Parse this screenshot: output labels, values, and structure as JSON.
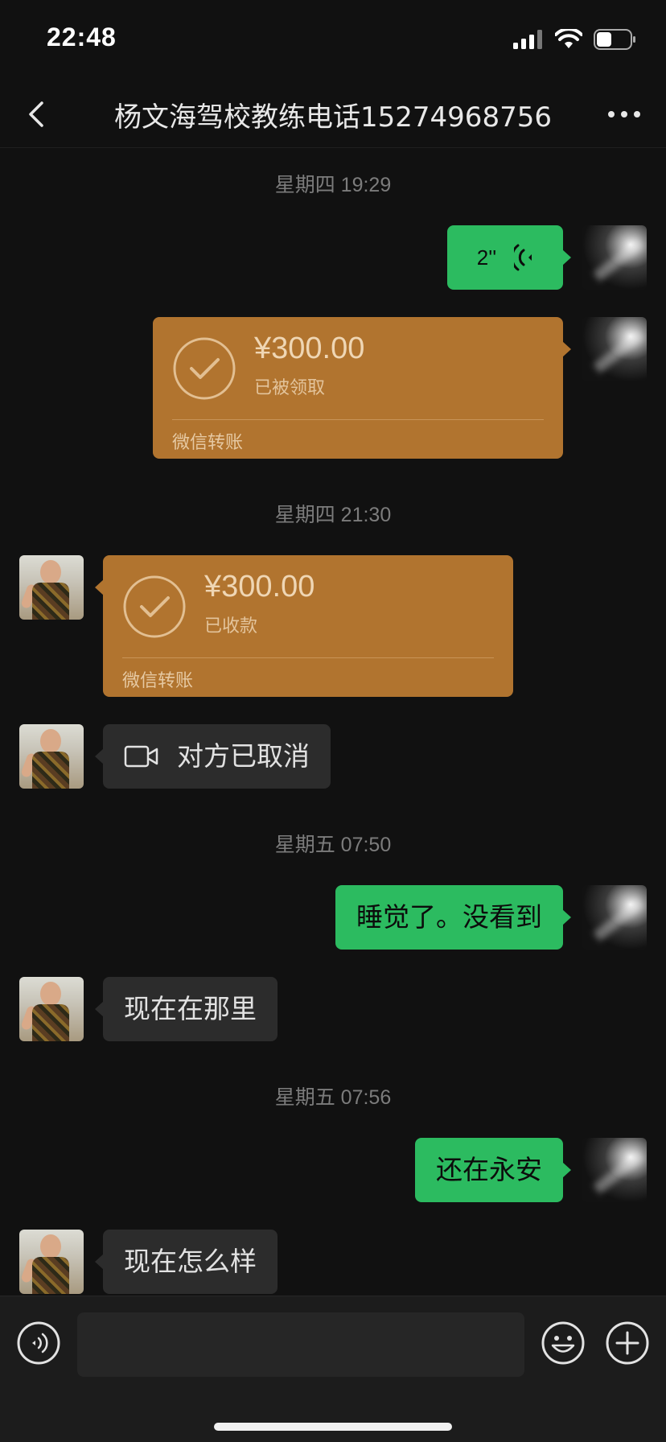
{
  "status_bar": {
    "time": "22:48",
    "battery_level": 0.45
  },
  "nav": {
    "title": "杨文海驾校教练电话15274968756",
    "back_icon": "chevron-left-icon",
    "more_icon": "more-dots-icon"
  },
  "messages": [
    {
      "type": "timestamp",
      "text": "星期四 19:29"
    },
    {
      "type": "voice",
      "from": "me",
      "duration": "2''"
    },
    {
      "type": "transfer",
      "from": "me",
      "amount": "¥300.00",
      "status": "已被领取",
      "brand": "微信转账"
    },
    {
      "type": "timestamp",
      "text": "星期四 21:30"
    },
    {
      "type": "transfer",
      "from": "them",
      "amount": "¥300.00",
      "status": "已收款",
      "brand": "微信转账"
    },
    {
      "type": "video_call",
      "from": "them",
      "text": "对方已取消"
    },
    {
      "type": "timestamp",
      "text": "星期五 07:50"
    },
    {
      "type": "text",
      "from": "me",
      "text": "睡觉了。没看到"
    },
    {
      "type": "text",
      "from": "them",
      "text": "现在在那里"
    },
    {
      "type": "timestamp",
      "text": "星期五 07:56"
    },
    {
      "type": "text",
      "from": "me",
      "text": "还在永安"
    },
    {
      "type": "text",
      "from": "them",
      "text": "现在怎么样"
    }
  ],
  "input_bar": {
    "placeholder": "",
    "voice_icon": "voice-input-icon",
    "emoji_icon": "emoji-icon",
    "plus_icon": "plus-icon"
  },
  "colors": {
    "background": "#111111",
    "my_bubble": "#2cbb60",
    "their_bubble": "#2c2c2c",
    "transfer": "#b1742f",
    "timestamp": "#7c7c7c"
  }
}
